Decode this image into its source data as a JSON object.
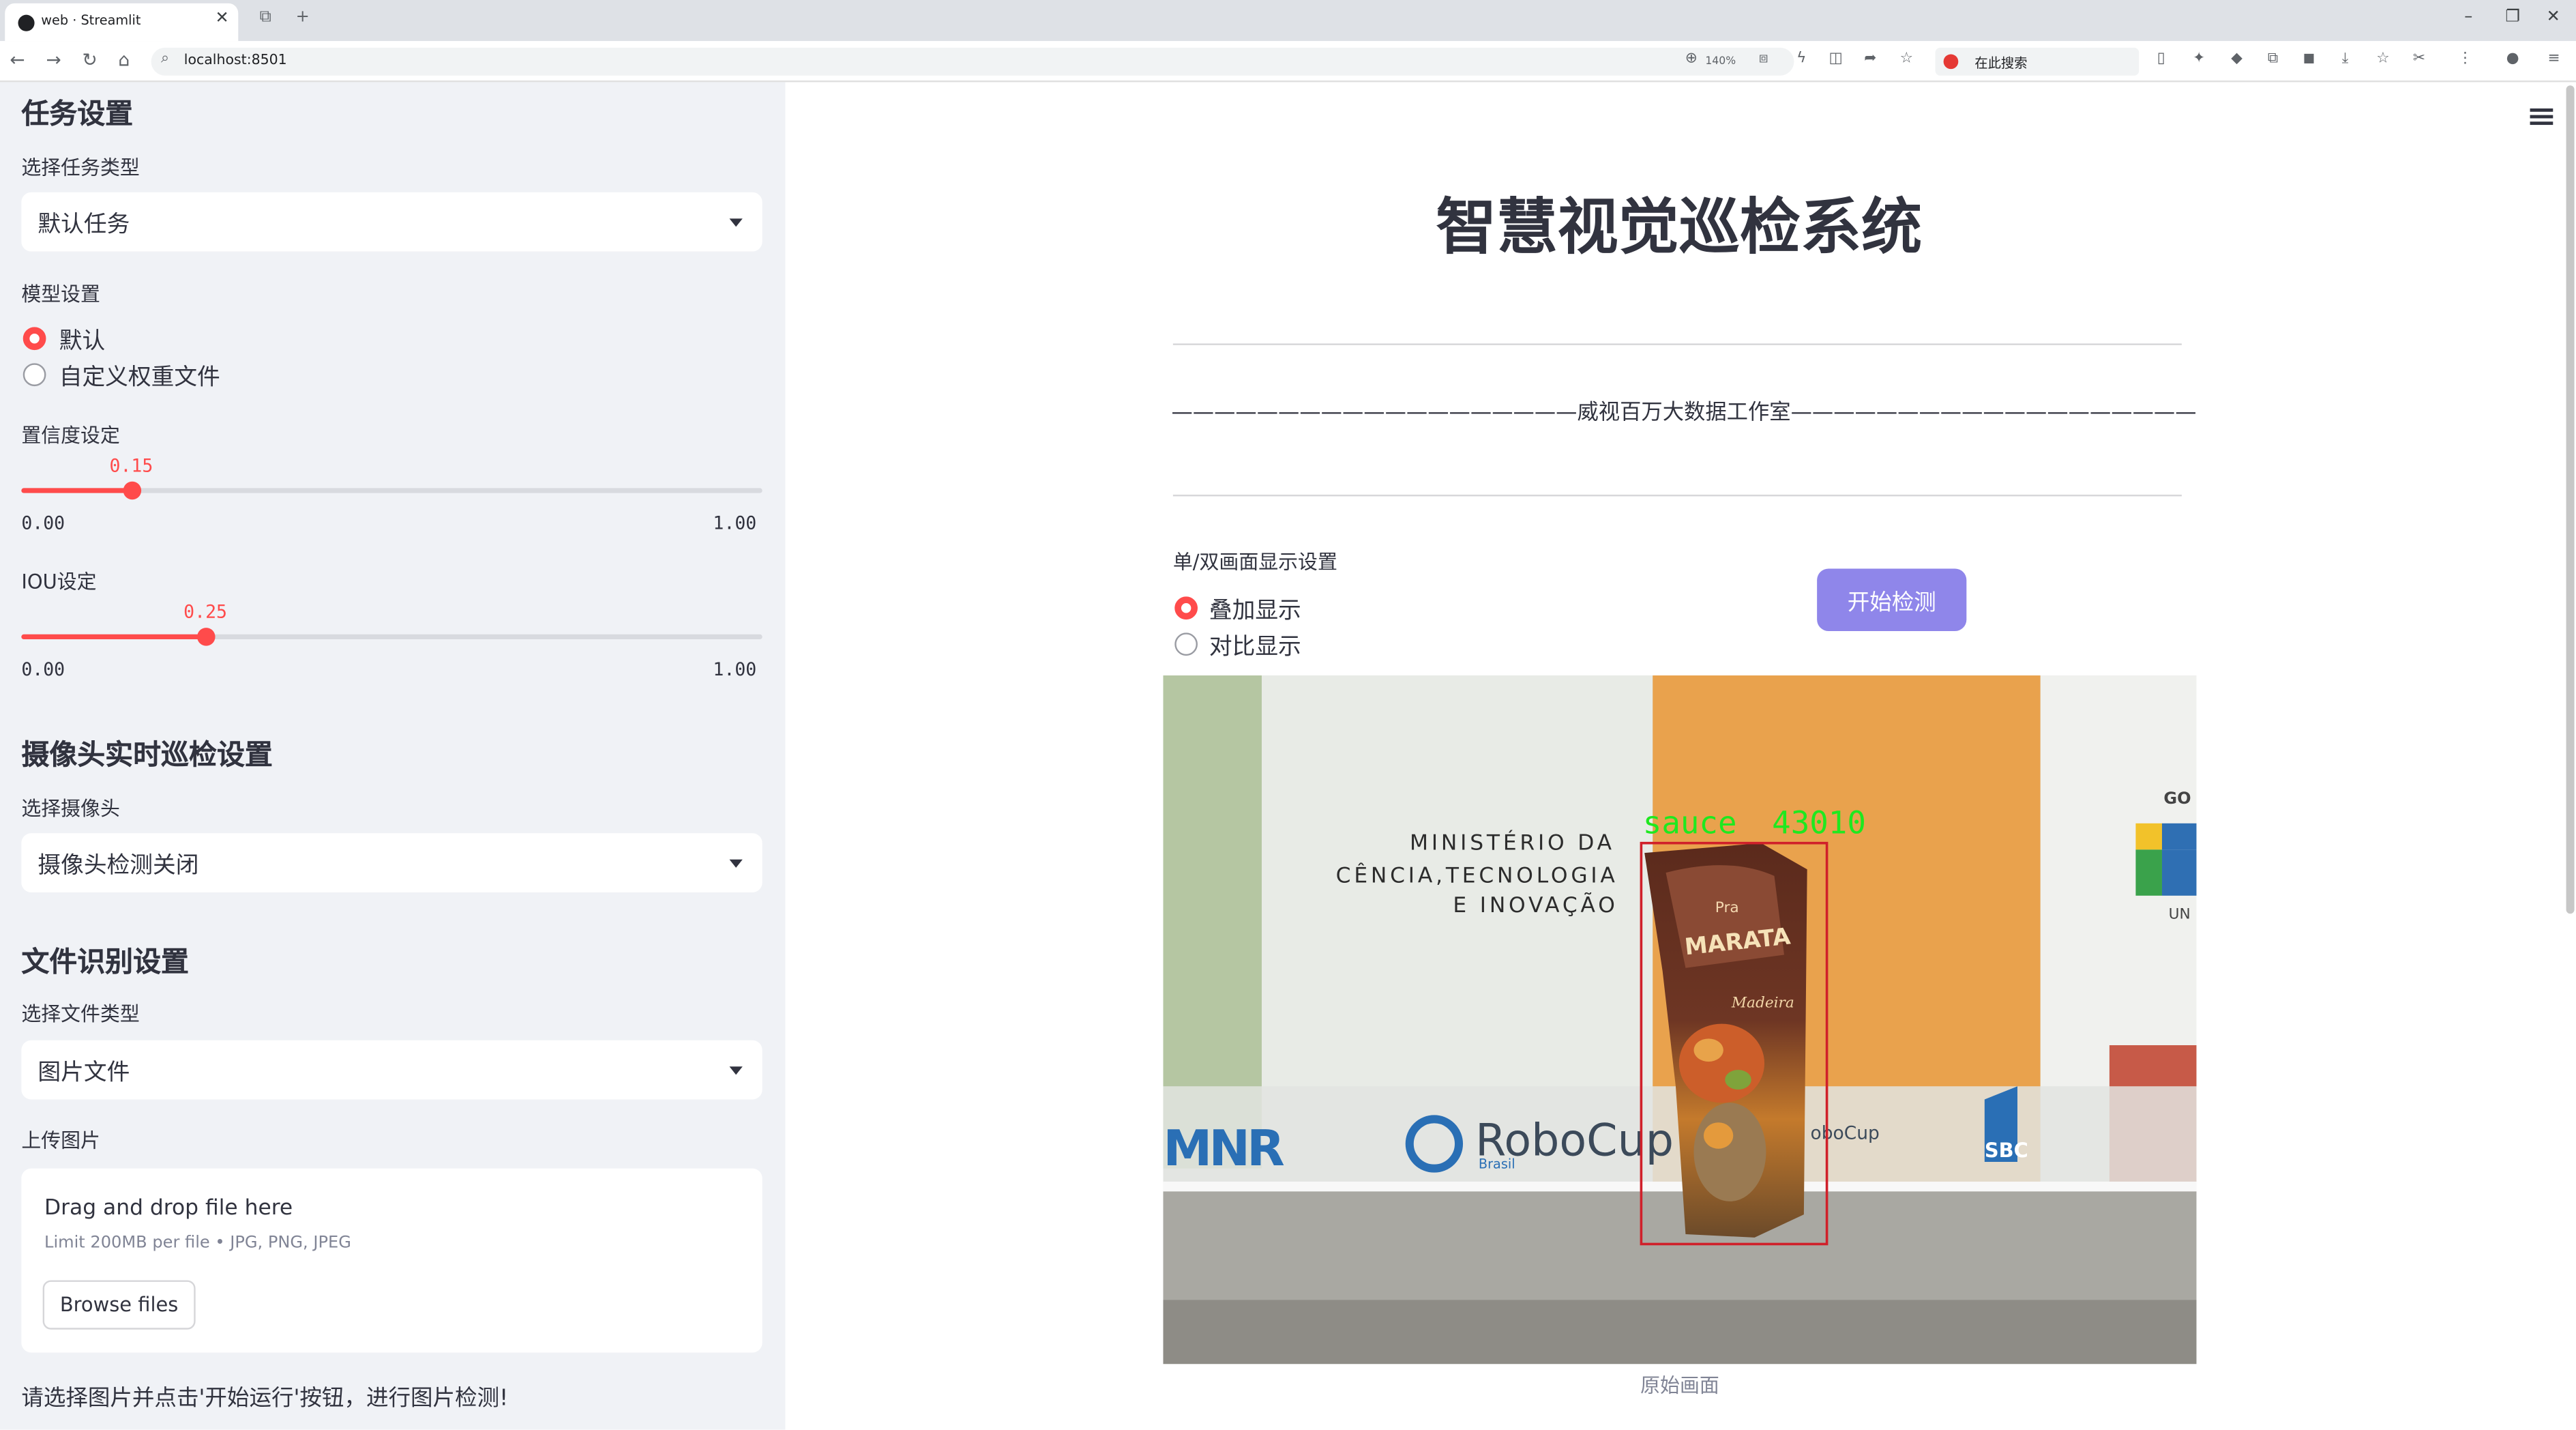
{
  "browser": {
    "tab_title": "web · Streamlit",
    "url": "localhost:8501",
    "zoom": "140%",
    "search_placeholder": "在此搜索"
  },
  "sidebar": {
    "task_section_title": "任务设置",
    "task_type_label": "选择任务类型",
    "task_type_value": "默认任务",
    "model_label": "模型设置",
    "model_options": [
      "默认",
      "自定义权重文件"
    ],
    "model_selected": "默认",
    "conf_label": "置信度设定",
    "conf_value": 0.15,
    "conf_value_text": "0.15",
    "iou_label": "IOU设定",
    "iou_value": 0.25,
    "iou_value_text": "0.25",
    "slider_min": "0.00",
    "slider_max": "1.00",
    "camera_section_title": "摄像头实时巡检设置",
    "camera_label": "选择摄像头",
    "camera_value": "摄像头检测关闭",
    "file_section_title": "文件识别设置",
    "file_type_label": "选择文件类型",
    "file_type_value": "图片文件",
    "upload_label": "上传图片",
    "upload_title": "Drag and drop file here",
    "upload_limit": "Limit 200MB per file • JPG, PNG, JPEG",
    "browse_label": "Browse files",
    "hint": "请选择图片并点击'开始运行'按钮，进行图片检测!"
  },
  "main": {
    "title": "智慧视觉巡检系统",
    "studio": "———————————————————威视百万大数据工作室———————————————————",
    "display_label": "单/双画面显示设置",
    "display_options": [
      "叠加显示",
      "对比显示"
    ],
    "display_selected": "叠加显示",
    "start_button": "开始检测",
    "caption": "原始画面",
    "detection": {
      "label": "sauce",
      "score_text": "43010",
      "box_color": "#d0202a",
      "label_color": "#1fe81f"
    },
    "scene_text": {
      "ministry": [
        "MINISTÉRIO DA",
        "CÊNCIA,TECNOLOGIA",
        "E INOVAÇÃO"
      ],
      "robocup": "RoboCup",
      "robocup_sub": "Brasil",
      "mnr": "MNR",
      "sbc": "SBC",
      "robocup_small": "oboCup",
      "edge_top": "GO",
      "edge_bottom": "UN",
      "package_brand": "MARATA",
      "package_top": "Pra",
      "package_mid": "Madeira"
    }
  },
  "colors": {
    "accent": "#ff4b4b",
    "button": "#8f86ea",
    "sidebar_bg": "#f0f2f6",
    "text": "#31333f"
  }
}
